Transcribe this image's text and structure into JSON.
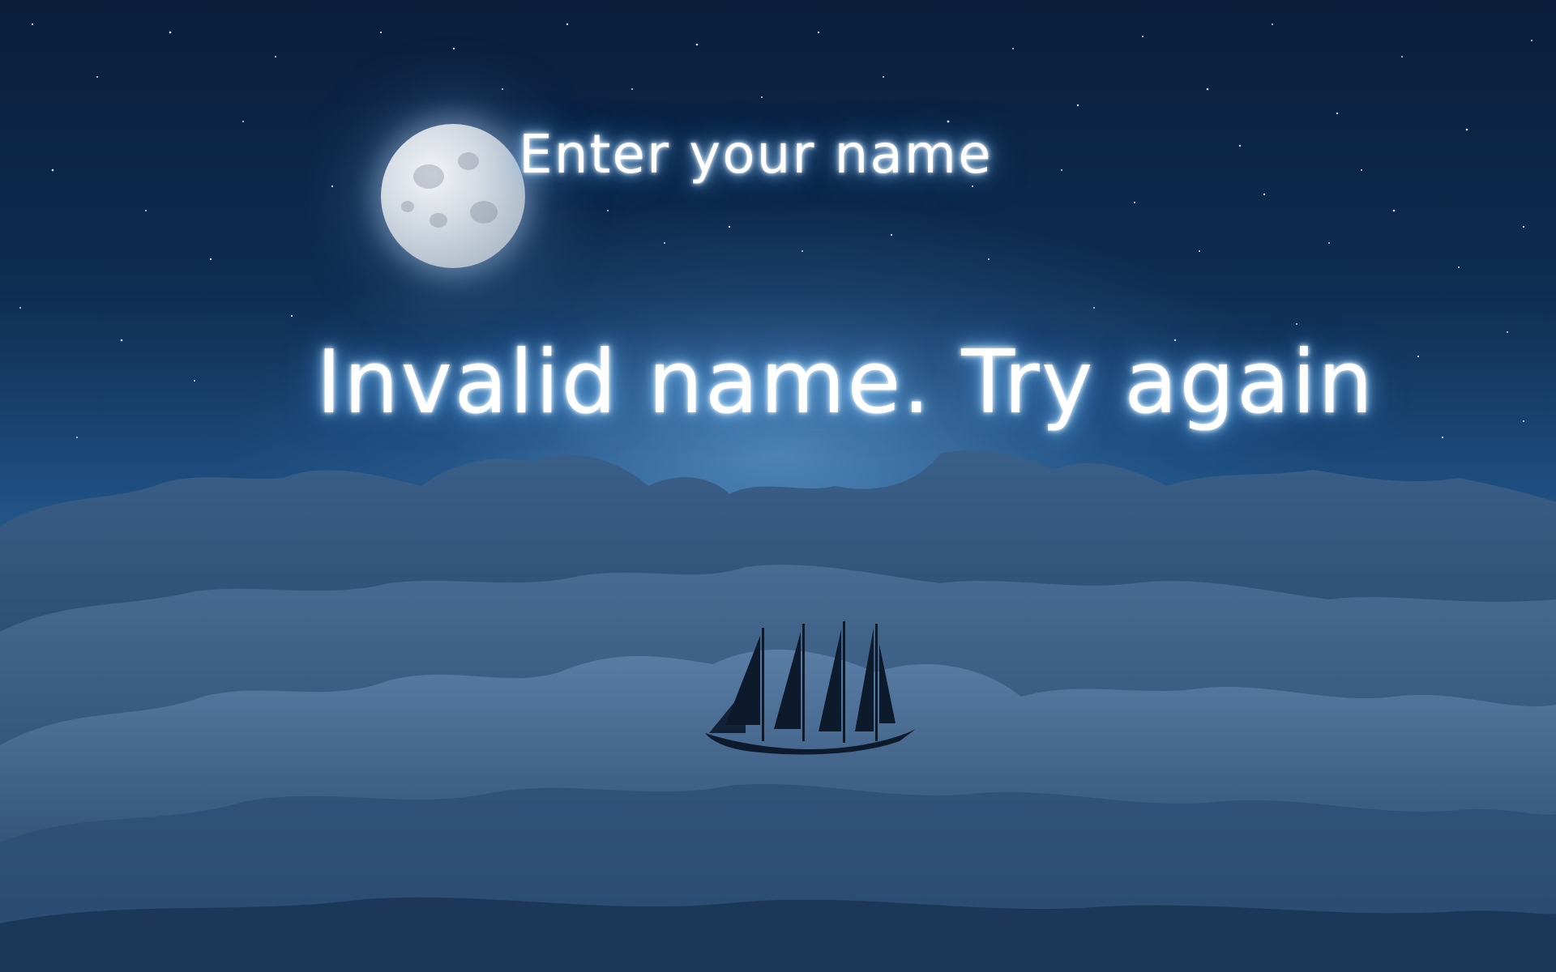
{
  "prompt": {
    "title": "Enter your name"
  },
  "error": {
    "message": "Invalid name. Try again"
  },
  "icons": {
    "moon": "moon-icon",
    "ship": "sailing-ship-icon"
  },
  "colors": {
    "text": "#ffffff",
    "glow": "#7fc8ff",
    "sky_top": "#0a1e3a",
    "horizon": "#2a5f90",
    "cloud": "#2b4a70"
  }
}
